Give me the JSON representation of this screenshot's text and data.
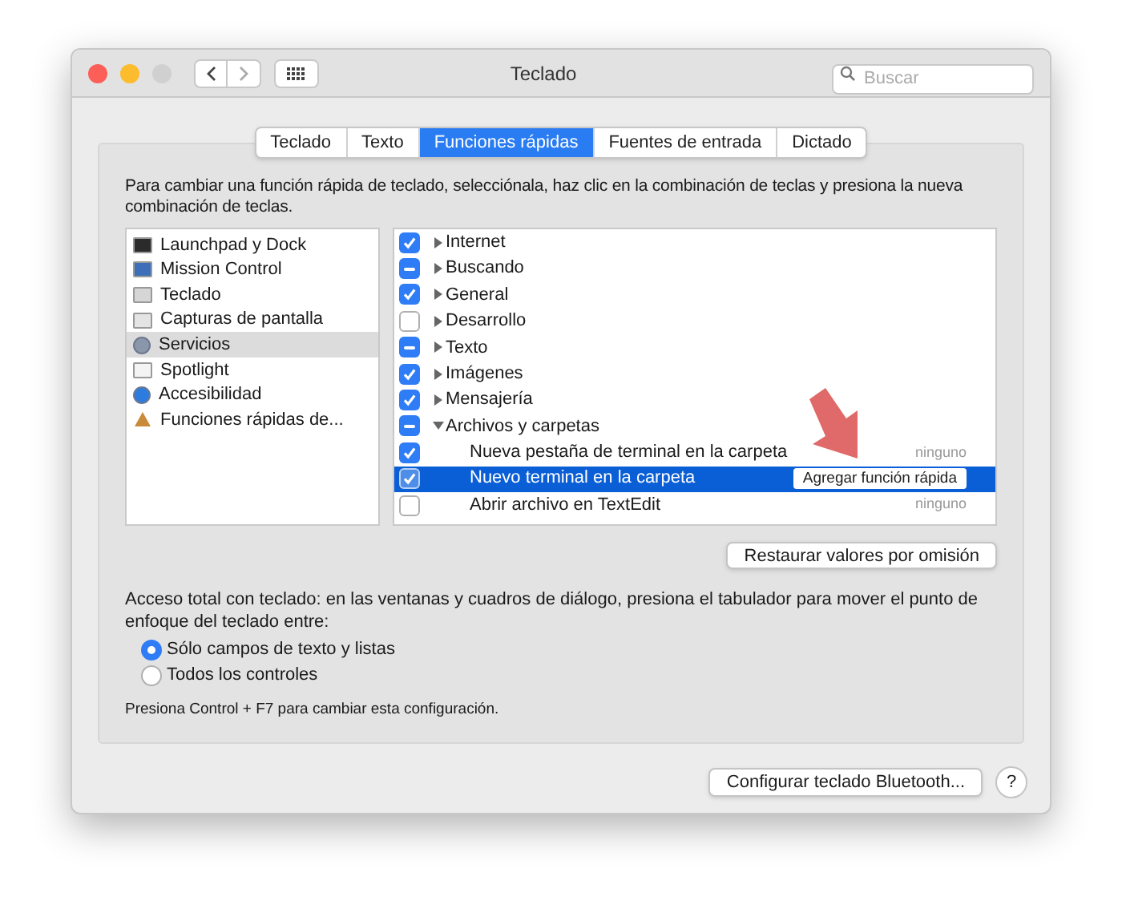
{
  "window": {
    "title": "Teclado",
    "search": {
      "placeholder": "Buscar"
    }
  },
  "tabs": [
    {
      "label": "Teclado",
      "selected": false
    },
    {
      "label": "Texto",
      "selected": false
    },
    {
      "label": "Funciones rápidas",
      "selected": true
    },
    {
      "label": "Fuentes de entrada",
      "selected": false
    },
    {
      "label": "Dictado",
      "selected": false
    }
  ],
  "instructions": "Para cambiar una función rápida de teclado, selecciónala, haz clic en la combinación de teclas y presiona la nueva combinación de teclas.",
  "categories": [
    {
      "label": "Launchpad y Dock",
      "selected": false
    },
    {
      "label": "Mission Control",
      "selected": false
    },
    {
      "label": "Teclado",
      "selected": false
    },
    {
      "label": "Capturas de pantalla",
      "selected": false
    },
    {
      "label": "Servicios",
      "selected": true
    },
    {
      "label": "Spotlight",
      "selected": false
    },
    {
      "label": "Accesibilidad",
      "selected": false
    },
    {
      "label": "Funciones rápidas de...",
      "selected": false
    }
  ],
  "services": [
    {
      "label": "Internet",
      "checked": true,
      "expanded": false
    },
    {
      "label": "Buscando",
      "checked": true,
      "mixed": true,
      "expanded": false
    },
    {
      "label": "General",
      "checked": true,
      "expanded": false
    },
    {
      "label": "Desarrollo",
      "checked": false,
      "expanded": false
    },
    {
      "label": "Texto",
      "checked": true,
      "mixed": true,
      "expanded": false
    },
    {
      "label": "Imágenes",
      "checked": true,
      "expanded": false
    },
    {
      "label": "Mensajería",
      "checked": true,
      "expanded": false
    },
    {
      "label": "Archivos y carpetas",
      "checked": true,
      "mixed": true,
      "expanded": true,
      "children": [
        {
          "label": "Nueva pestaña de terminal en la carpeta",
          "checked": true,
          "selected": false,
          "shortcut": "ninguno"
        },
        {
          "label": "Nuevo terminal en la carpeta",
          "checked": true,
          "selected": true,
          "shortcut": "Agregar función rápida"
        },
        {
          "label": "Abrir archivo en TextEdit",
          "checked": false,
          "selected": false,
          "shortcut": "ninguno"
        }
      ]
    }
  ],
  "restore_button": "Restaurar valores por omisión",
  "keyboard_access": {
    "description": "Acceso total con teclado: en las ventanas y cuadros de diálogo, presiona el tabulador para mover el punto de enfoque del teclado entre:",
    "options": [
      {
        "label": "Sólo campos de texto y listas",
        "selected": true
      },
      {
        "label": "Todos los controles",
        "selected": false
      }
    ],
    "hint": "Presiona Control + F7 para cambiar esta configuración."
  },
  "bluetooth_button": "Configurar teclado Bluetooth...",
  "help_button": "?"
}
